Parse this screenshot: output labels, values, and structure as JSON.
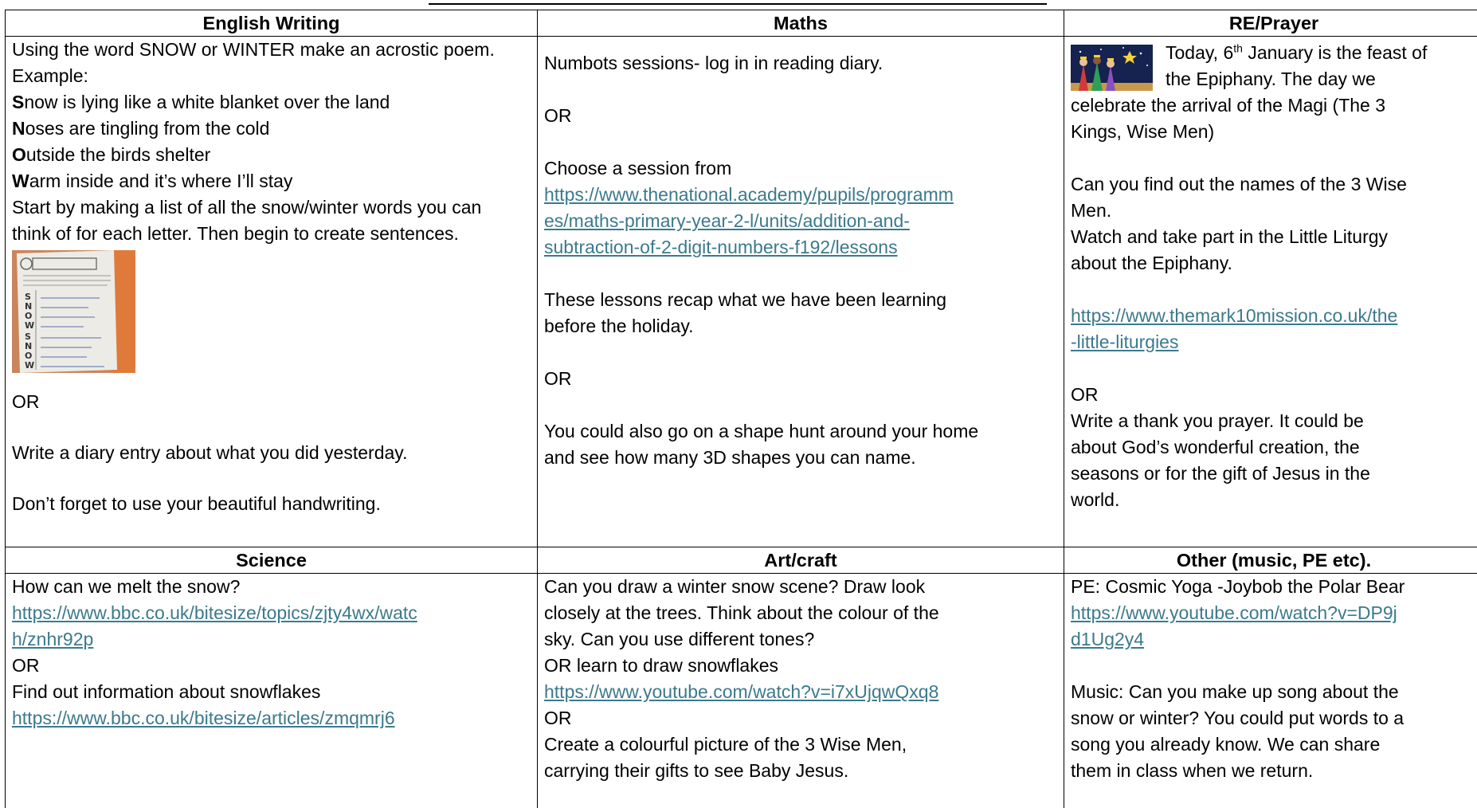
{
  "headers": {
    "english": "English Writing",
    "maths": "Maths",
    "re": "RE/Prayer",
    "science": "Science",
    "art": "Art/craft",
    "other": "Other (music, PE etc)."
  },
  "english": {
    "intro_1": "Using the word SNOW or WINTER make an acrostic poem.",
    "intro_2": "Example:",
    "poem": [
      {
        "first": "S",
        "rest": "now is lying like a white blanket over the land"
      },
      {
        "first": "N",
        "rest": "oses are tingling from the cold"
      },
      {
        "first": "O",
        "rest": "utside the birds shelter"
      },
      {
        "first": "W",
        "rest": "arm inside and it’s where I’ll stay"
      }
    ],
    "instructions_1": "Start by making a list of all the snow/winter words you can",
    "instructions_2": "think of for each letter. Then begin to create sentences.",
    "worksheet_letters": [
      "S",
      "N",
      "O",
      "W",
      "S",
      "N",
      "O",
      "W"
    ],
    "or": "OR",
    "diary": "Write a diary entry about what you did yesterday.",
    "handwriting": "Don’t forget to use your beautiful handwriting."
  },
  "maths": {
    "numbots": "Numbots sessions- log in in reading diary.",
    "or_1": "OR",
    "choose": "Choose a session from",
    "link_1": "https://www.thenational.academy/pupils/programm",
    "link_2": "es/maths-primary-year-2-l/units/addition-and-",
    "link_3": "subtraction-of-2-digit-numbers-f192/lessons",
    "recap_1": "These lessons recap what we have been learning",
    "recap_2": "before the holiday.",
    "or_2": "OR",
    "shape_1": "You could also go on a shape hunt around your home",
    "shape_2": "and see how many 3D shapes you can name."
  },
  "re": {
    "today_a": "Today, 6",
    "today_sup": "th",
    "today_b": " January is the feast of",
    "epiphany": "the Epiphany. The day we",
    "celebrate": "celebrate the arrival of the Magi (The 3",
    "kings": "Kings, Wise Men)",
    "names_1": "Can you find out the names of the 3 Wise",
    "names_2": "Men.",
    "watch_1": "Watch and take part in the Little Liturgy",
    "watch_2": "about the Epiphany.",
    "link_1": "https://www.themark10mission.co.uk/the",
    "link_2": "-little-liturgies",
    "or": "OR",
    "prayer_1": "Write a thank you prayer. It could be",
    "prayer_2": "about God’s wonderful creation, the",
    "prayer_3": "seasons or for the gift of Jesus in the",
    "prayer_4": "world."
  },
  "science": {
    "melt": "How can we melt the snow?",
    "link_1a": "https://www.bbc.co.uk/bitesize/topics/zjty4wx/watc",
    "link_1b": "h/znhr92p",
    "or": "OR",
    "info": "Find out information about snowflakes",
    "link_2": "https://www.bbc.co.uk/bitesize/articles/zmqmrj6"
  },
  "art": {
    "draw_1": "Can you draw a winter snow scene? Draw look",
    "draw_2": "closely at the trees. Think about the colour of the",
    "draw_3": "sky. Can you use different tones?",
    "snowflakes": "OR learn to draw snowflakes",
    "link": "https://www.youtube.com/watch?v=i7xUjqwQxq8",
    "or": "OR",
    "picture_1": "Create a colourful picture of the 3 Wise Men,",
    "picture_2": "carrying their gifts to see Baby Jesus."
  },
  "other": {
    "pe": "PE: Cosmic Yoga -Joybob the Polar Bear",
    "link_1": "https://www.youtube.com/watch?v=DP9j",
    "link_2": "d1Ug2y4",
    "music_1": "Music: Can you make up song about the",
    "music_2": "snow or winter? You could put words to a",
    "music_3": "song you already know. We can share",
    "music_4": "them in class when we return."
  },
  "colors": {
    "link": "#3b7a8c",
    "border": "#000000"
  }
}
